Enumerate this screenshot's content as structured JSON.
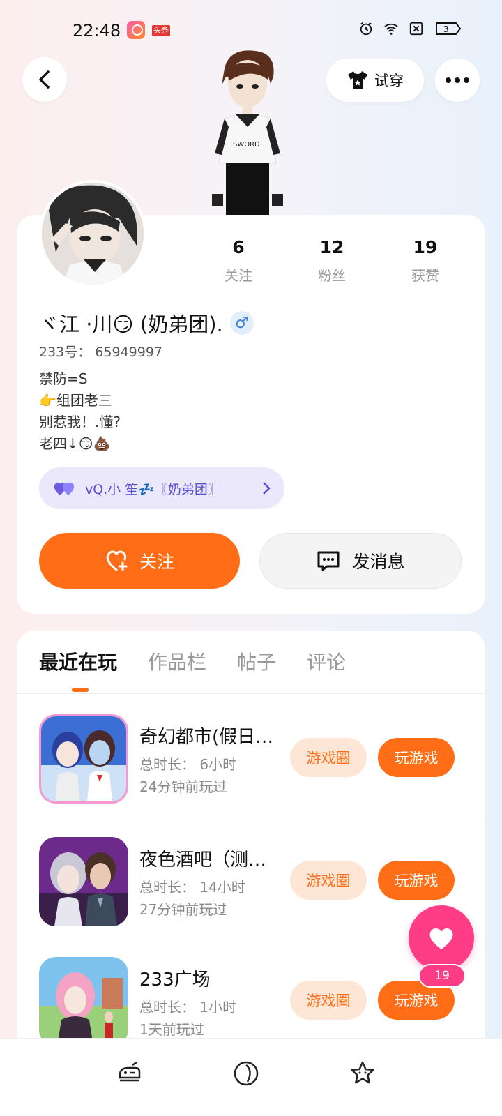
{
  "status": {
    "time": "22:48",
    "app2_label": "头条",
    "battery": "3"
  },
  "header": {
    "try_on_label": "试穿"
  },
  "profile": {
    "stats": [
      {
        "value": "6",
        "label": "关注"
      },
      {
        "value": "12",
        "label": "粉丝"
      },
      {
        "value": "19",
        "label": "获赞"
      }
    ],
    "username": "ヾ江 ·川😏 (奶弟团).",
    "gender": "♂",
    "user_id": "233号： 65949997",
    "bio": [
      "禁防=S",
      "👉组团老三",
      "别惹我！.懂?",
      "老四↓😏💩"
    ],
    "group_tag": "vQ.小 笙💤〖奶弟团〗",
    "follow_label": "关注",
    "message_label": "发消息"
  },
  "tabs": [
    {
      "label": "最近在玩",
      "active": true
    },
    {
      "label": "作品栏",
      "active": false
    },
    {
      "label": "帖子",
      "active": false
    },
    {
      "label": "评论",
      "active": false
    }
  ],
  "games": [
    {
      "title": "奇幻都市(假日…",
      "duration": "总时长： 6小时",
      "last_played": "24分钟前玩过",
      "circle_label": "游戏圈",
      "play_label": "玩游戏"
    },
    {
      "title": "夜色酒吧（测…",
      "duration": "总时长： 14小时",
      "last_played": "27分钟前玩过",
      "circle_label": "游戏圈",
      "play_label": "玩游戏"
    },
    {
      "title": "233广场",
      "duration": "总时长： 1小时",
      "last_played": "1天前玩过",
      "circle_label": "游戏圈",
      "play_label": "玩游戏"
    }
  ],
  "like": {
    "count": "19"
  },
  "colors": {
    "accent": "#ff6e16",
    "like": "#ff3d86",
    "group_bg": "#ebe8fb",
    "group_text": "#5a4fcf"
  },
  "icons": {
    "back": "back-arrow-icon",
    "try_on": "tshirt-icon",
    "more": "more-dots-icon",
    "follow": "heart-plus-icon",
    "message": "chat-bubble-icon",
    "like": "heart-icon",
    "nav": [
      "party-icon",
      "globe-icon",
      "star-face-icon"
    ]
  }
}
